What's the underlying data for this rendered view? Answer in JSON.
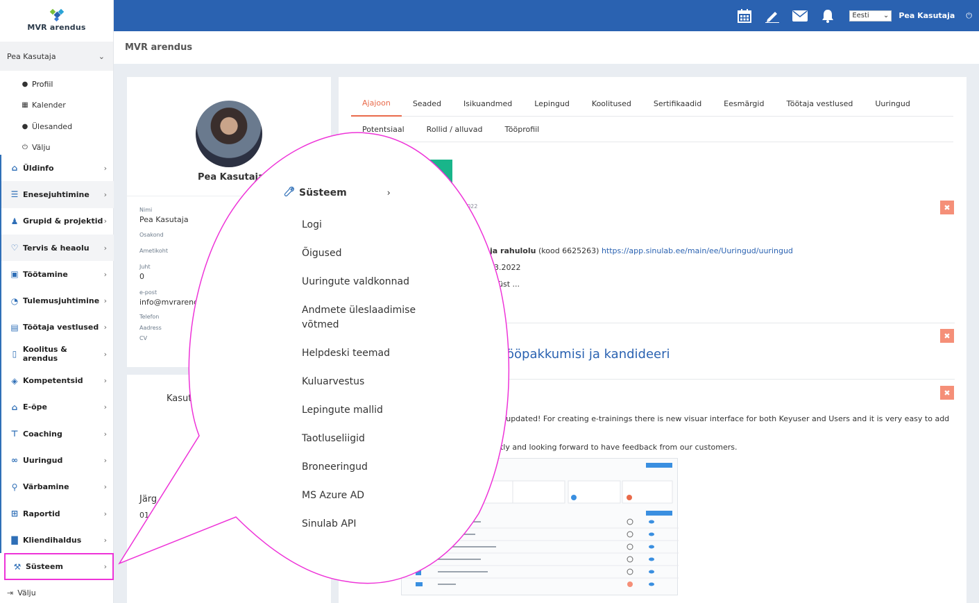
{
  "app": {
    "logo_text": "MVR arendus",
    "page_title": "MVR arendus"
  },
  "topbar": {
    "language": "Eesti",
    "user": "Pea Kasutaja"
  },
  "sidebar": {
    "user_toggle": "Pea Kasutaja",
    "sub_items": [
      "Profiil",
      "Kalender",
      "Ülesanded",
      "Välju"
    ],
    "items": [
      "Üldinfo",
      "Enesejuhtimine",
      "Grupid & projektid",
      "Tervis & heaolu",
      "Töötamine",
      "Tulemusjuhtimine",
      "Töötaja vestlused",
      "Koolitus & arendus",
      "Kompetentsid",
      "E-õpe",
      "Coaching",
      "Uuringud",
      "Värbamine",
      "Raportid",
      "Kliendihaldus",
      "Süsteem"
    ],
    "logout": "Välju"
  },
  "profile": {
    "name": "Pea Kasutaja",
    "fields": [
      {
        "label": "Nimi",
        "value": "Pea Kasutaja"
      },
      {
        "label": "Osakond",
        "value": ""
      },
      {
        "label": "Ametikoht",
        "value": ""
      },
      {
        "label": "Juht",
        "value": "0"
      },
      {
        "label": "e-post",
        "value": "info@mvrarend"
      },
      {
        "label": "Telefon",
        "value": ""
      },
      {
        "label": "Aadress",
        "value": ""
      },
      {
        "label": "CV",
        "value": ""
      }
    ]
  },
  "second_card": {
    "label1": "Kasut",
    "label2": "Järg",
    "label3": "01"
  },
  "tabs": {
    "row1": [
      "Ajajoon",
      "Seaded",
      "Isikuandmed",
      "Lepingud",
      "Koolitused",
      "Sertifikaadid",
      "Eesmärgid",
      "Töötaja vestlused",
      "Uuringud"
    ],
    "row2": [
      "Potentsiaal",
      "Rollid / alluvad",
      "Tööprofiil"
    ],
    "active": "Ajajoon"
  },
  "news": {
    "date1": "2022",
    "survey_bold": "ja rahulolu",
    "survey_code": " (kood 6625263) ",
    "survey_link": "https://app.sinulab.ee/main/ee/Uuringud/uuringud",
    "survey_date": "3.2022",
    "survey_more": "üst ...",
    "title2": "ööpakkumisi ja kandideeri",
    "body3a": "s updated! For creating e-trainings there is new visuar interface for both Keyuser and Users and it is very easy to add",
    "body3b": "ntly and looking forward to have feedback from our customers.",
    "close_glyph": "✖"
  },
  "callout": {
    "title": "Süsteem",
    "items": [
      "Logi",
      "Õigused",
      "Uuringute valdkonnad",
      "Andmete üleslaadimise võtmed",
      "Helpdeski teemad",
      "Kuluarvestus",
      "Lepingute mallid",
      "Taotluseliigid",
      "Broneeringud",
      "MS Azure AD",
      "Sinulab API"
    ]
  },
  "colors": {
    "topbar": "#2a62b1",
    "accent": "#e96a4a",
    "callout_border": "#ee33d8"
  }
}
